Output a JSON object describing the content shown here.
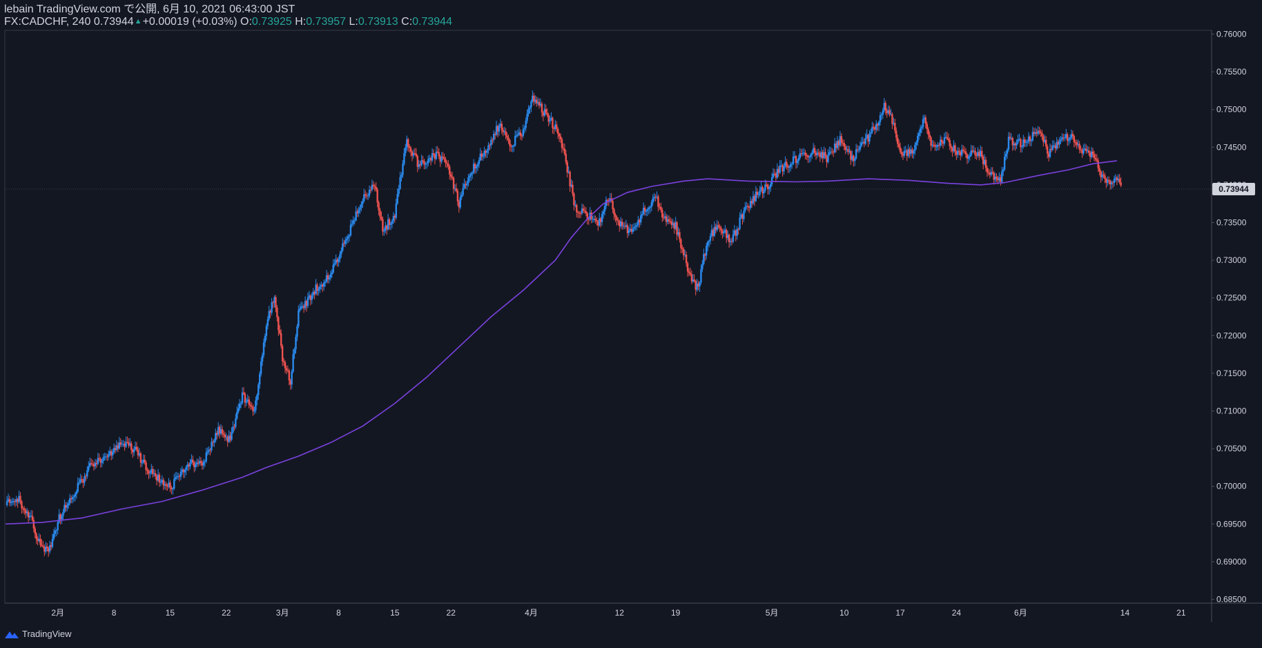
{
  "header": {
    "publish_line": "lebain TradingView.com で公開, 6月 10, 2021 06:43:00 JST",
    "symbol": "FX:CADCHF, 240",
    "last": "0.73944",
    "change": "+0.00019 (+0.03%)",
    "o_label": "O:",
    "o_value": "0.73925",
    "h_label": "H:",
    "h_value": "0.73957",
    "l_label": "L:",
    "l_value": "0.73913",
    "c_label": "C:",
    "c_value": "0.73944"
  },
  "footer": {
    "brand": "TradingView"
  },
  "colors": {
    "background": "#131722",
    "up": "#2a8bef",
    "down": "#ef5350",
    "ma": "#7b42e0",
    "grid_text": "#d1d4dc",
    "price_label_bg": "#d1d4dc"
  },
  "chart_data": {
    "type": "candlestick",
    "interval": "240",
    "y_ticks": [
      0.76,
      0.755,
      0.75,
      0.745,
      0.74,
      0.735,
      0.73,
      0.725,
      0.72,
      0.715,
      0.71,
      0.705,
      0.7,
      0.695,
      0.69,
      0.685
    ],
    "ylim": [
      0.6845,
      0.7605
    ],
    "x_ticks": [
      {
        "label": "2月",
        "day": 32
      },
      {
        "label": "8",
        "day": 39
      },
      {
        "label": "15",
        "day": 46
      },
      {
        "label": "22",
        "day": 53
      },
      {
        "label": "3月",
        "day": 60
      },
      {
        "label": "8",
        "day": 67
      },
      {
        "label": "15",
        "day": 74
      },
      {
        "label": "22",
        "day": 81
      },
      {
        "label": "4月",
        "day": 91
      },
      {
        "label": "12",
        "day": 102
      },
      {
        "label": "19",
        "day": 109
      },
      {
        "label": "5月",
        "day": 121
      },
      {
        "label": "10",
        "day": 130
      },
      {
        "label": "17",
        "day": 137
      },
      {
        "label": "24",
        "day": 144
      },
      {
        "label": "6月",
        "day": 152
      },
      {
        "label": "14",
        "day": 165
      },
      {
        "label": "21",
        "day": 172
      }
    ],
    "xlim_days": [
      25.4,
      175.8
    ],
    "last_price": 0.73944,
    "price_path": [
      [
        25.5,
        0.6975
      ],
      [
        27,
        0.6985
      ],
      [
        28.5,
        0.696
      ],
      [
        30,
        0.6915
      ],
      [
        31.2,
        0.692
      ],
      [
        32,
        0.6955
      ],
      [
        34,
        0.699
      ],
      [
        36,
        0.7025
      ],
      [
        38,
        0.704
      ],
      [
        40,
        0.7055
      ],
      [
        41.5,
        0.705
      ],
      [
        43,
        0.7025
      ],
      [
        45,
        0.7005
      ],
      [
        46.2,
        0.7
      ],
      [
        48,
        0.703
      ],
      [
        50,
        0.703
      ],
      [
        52,
        0.7075
      ],
      [
        53.5,
        0.706
      ],
      [
        55,
        0.712
      ],
      [
        56.5,
        0.71
      ],
      [
        58,
        0.7215
      ],
      [
        59,
        0.7255
      ],
      [
        60,
        0.717
      ],
      [
        61,
        0.714
      ],
      [
        62,
        0.723
      ],
      [
        64,
        0.726
      ],
      [
        66,
        0.728
      ],
      [
        68,
        0.733
      ],
      [
        70,
        0.738
      ],
      [
        71.5,
        0.74
      ],
      [
        72.5,
        0.734
      ],
      [
        74,
        0.736
      ],
      [
        75.5,
        0.746
      ],
      [
        77,
        0.7425
      ],
      [
        79,
        0.744
      ],
      [
        80.5,
        0.743
      ],
      [
        82,
        0.7375
      ],
      [
        83.5,
        0.742
      ],
      [
        85,
        0.744
      ],
      [
        87,
        0.748
      ],
      [
        88.5,
        0.7455
      ],
      [
        90,
        0.747
      ],
      [
        91,
        0.7515
      ],
      [
        92,
        0.7505
      ],
      [
        93,
        0.749
      ],
      [
        94.5,
        0.747
      ],
      [
        95.5,
        0.742
      ],
      [
        96.5,
        0.737
      ],
      [
        98,
        0.736
      ],
      [
        99.5,
        0.735
      ],
      [
        100.5,
        0.7385
      ],
      [
        102,
        0.735
      ],
      [
        103.5,
        0.7335
      ],
      [
        105,
        0.7365
      ],
      [
        106.5,
        0.7385
      ],
      [
        107.5,
        0.7355
      ],
      [
        109,
        0.7345
      ],
      [
        110,
        0.731
      ],
      [
        111,
        0.727
      ],
      [
        111.8,
        0.7265
      ],
      [
        113,
        0.733
      ],
      [
        114.5,
        0.7345
      ],
      [
        116,
        0.7325
      ],
      [
        117.5,
        0.7365
      ],
      [
        119,
        0.7385
      ],
      [
        120.5,
        0.74
      ],
      [
        122,
        0.742
      ],
      [
        124,
        0.7435
      ],
      [
        126,
        0.7445
      ],
      [
        128,
        0.7435
      ],
      [
        129.5,
        0.746
      ],
      [
        131,
        0.7435
      ],
      [
        132.5,
        0.7455
      ],
      [
        134,
        0.748
      ],
      [
        135,
        0.7505
      ],
      [
        136,
        0.7485
      ],
      [
        137,
        0.744
      ],
      [
        138.5,
        0.7445
      ],
      [
        140,
        0.749
      ],
      [
        141,
        0.745
      ],
      [
        142.5,
        0.746
      ],
      [
        144,
        0.7445
      ],
      [
        145.5,
        0.744
      ],
      [
        147,
        0.744
      ],
      [
        148,
        0.7415
      ],
      [
        149.5,
        0.7405
      ],
      [
        150.5,
        0.746
      ],
      [
        152,
        0.7455
      ],
      [
        153.5,
        0.7465
      ],
      [
        154.5,
        0.747
      ],
      [
        155.5,
        0.744
      ],
      [
        157,
        0.746
      ],
      [
        158.5,
        0.7465
      ],
      [
        159.5,
        0.7445
      ],
      [
        161,
        0.744
      ],
      [
        162,
        0.7415
      ],
      [
        163,
        0.7405
      ],
      [
        164,
        0.741
      ],
      [
        164.5,
        0.73944
      ]
    ],
    "ma_path": [
      [
        25.5,
        0.695
      ],
      [
        30,
        0.6952
      ],
      [
        35,
        0.6958
      ],
      [
        40,
        0.697
      ],
      [
        45,
        0.698
      ],
      [
        50,
        0.6995
      ],
      [
        55,
        0.7012
      ],
      [
        58,
        0.7025
      ],
      [
        62,
        0.704
      ],
      [
        66,
        0.7058
      ],
      [
        70,
        0.708
      ],
      [
        74,
        0.711
      ],
      [
        78,
        0.7145
      ],
      [
        82,
        0.7185
      ],
      [
        86,
        0.7225
      ],
      [
        90,
        0.726
      ],
      [
        94,
        0.73
      ],
      [
        96,
        0.733
      ],
      [
        98,
        0.7355
      ],
      [
        100,
        0.7375
      ],
      [
        103,
        0.739
      ],
      [
        106,
        0.7398
      ],
      [
        110,
        0.7405
      ],
      [
        113,
        0.7408
      ],
      [
        118,
        0.7405
      ],
      [
        124,
        0.7404
      ],
      [
        128,
        0.7405
      ],
      [
        133,
        0.7408
      ],
      [
        138,
        0.7406
      ],
      [
        143,
        0.7402
      ],
      [
        147,
        0.74
      ],
      [
        150,
        0.7403
      ],
      [
        154,
        0.7412
      ],
      [
        158,
        0.742
      ],
      [
        161,
        0.7428
      ],
      [
        164,
        0.7432
      ]
    ]
  }
}
